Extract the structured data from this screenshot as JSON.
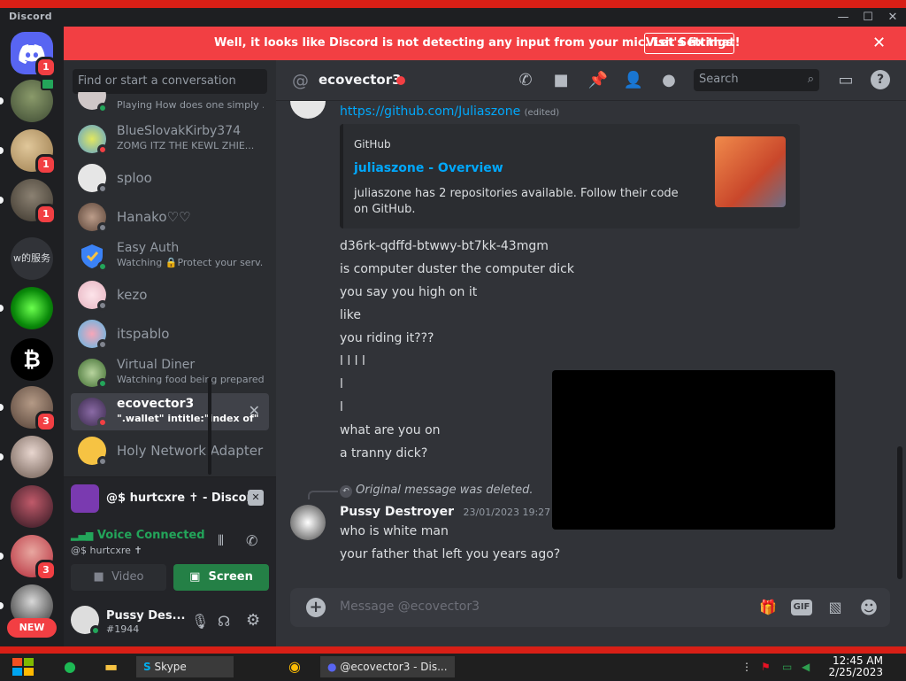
{
  "window": {
    "app_name": "Discord"
  },
  "banner": {
    "message": "Well, it looks like Discord is not detecting any input from your mic. Let's fix that!",
    "button_label": "Visit Settings"
  },
  "servers": [
    {
      "badge": "1"
    },
    {
      "badge": ""
    },
    {
      "badge": "1"
    },
    {
      "badge": "1"
    },
    {
      "label": "w的服务"
    },
    {
      "badge": ""
    },
    {
      "badge": ""
    },
    {
      "badge": "3"
    },
    {
      "badge": ""
    },
    {
      "badge": ""
    },
    {
      "badge": "3"
    },
    {
      "badge": ""
    }
  ],
  "new_badge": "NEW",
  "dm_search": {
    "placeholder": "Find or start a conversation"
  },
  "dms": [
    {
      "name": "",
      "status": "Playing How does one simply ..."
    },
    {
      "name": "BlueSlovakKirby374",
      "status": "ZOMG ITZ THE KEWL ZHIE..."
    },
    {
      "name": "sploo",
      "status": ""
    },
    {
      "name": "Hanako♡♡",
      "status": ""
    },
    {
      "name": "Easy Auth",
      "status": "Watching 🔒Protect your serv..."
    },
    {
      "name": "kezo",
      "status": ""
    },
    {
      "name": "itspablo",
      "status": ""
    },
    {
      "name": "Virtual Diner",
      "status": "Watching food being prepared!"
    },
    {
      "name": "ecovector3",
      "status": "\".wallet\" intitle:\"index of\""
    },
    {
      "name": "Holy Network Adapter",
      "status": ""
    }
  ],
  "voice": {
    "stream_title": "@$ hurtcxre ✝ - Discord",
    "connected_label": "Voice Connected",
    "channel": "@$ hurtcxre ✝",
    "video_label": "Video",
    "screen_label": "Screen"
  },
  "user": {
    "name": "Pussy Des...",
    "tag": "#1944"
  },
  "chat_header": {
    "name": "ecovector3",
    "search_placeholder": "Search"
  },
  "messages": {
    "link": "https://github.com/Juliaszone",
    "edited": "(edited)",
    "embed": {
      "provider": "GitHub",
      "title": "juliaszone - Overview",
      "description": "juliaszone has 2 repositories available. Follow their code on GitHub."
    },
    "lines": [
      "d36rk-qdffd-btwwy-bt7kk-43mgm",
      "is computer duster the computer dick",
      "you say you high on it",
      "like",
      "you riding it???",
      "l l l l",
      "l",
      "l",
      "what are you on",
      "a tranny dick?"
    ],
    "reply_note": "Original message was deleted.",
    "author": "Pussy Destroyer",
    "timestamp": "23/01/2023 19:27",
    "author_lines": [
      "who is white man",
      "your father that left you years ago?"
    ]
  },
  "composer": {
    "placeholder": "Message @ecovector3",
    "gif_label": "GIF"
  },
  "taskbar": {
    "skype": "Skype",
    "discord": "@ecovector3 - Dis...",
    "time": "12:45 AM",
    "date": "2/25/2023"
  }
}
